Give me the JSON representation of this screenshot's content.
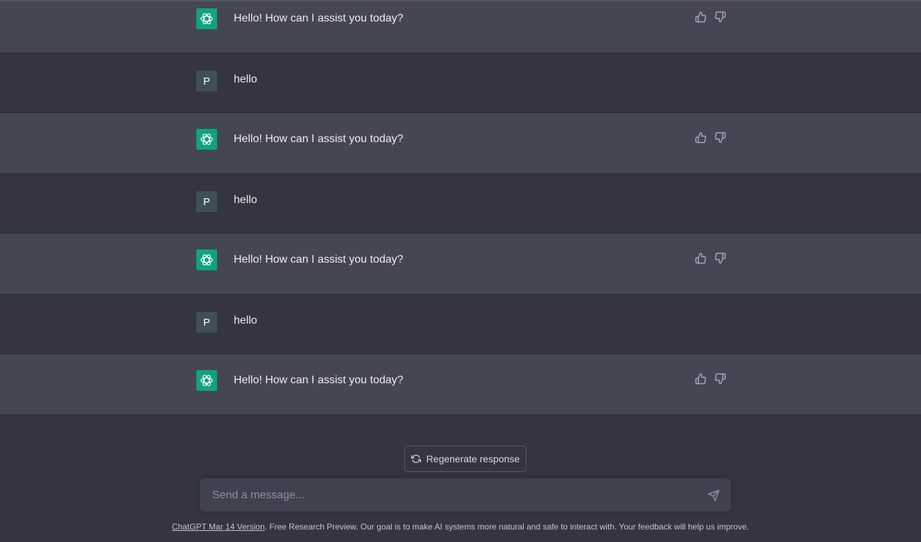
{
  "conversation": {
    "assistant_avatar_icon": "openai-logo-icon",
    "thumbs_up_icon": "thumbs-up-icon",
    "thumbs_down_icon": "thumbs-down-icon",
    "messages": [
      {
        "role": "assistant",
        "text": "Hello! How can I assist you today?"
      },
      {
        "role": "user",
        "avatar_letter": "P",
        "text": "hello"
      },
      {
        "role": "assistant",
        "text": "Hello! How can I assist you today?"
      },
      {
        "role": "user",
        "avatar_letter": "P",
        "text": "hello"
      },
      {
        "role": "assistant",
        "text": "Hello! How can I assist you today?"
      },
      {
        "role": "user",
        "avatar_letter": "P",
        "text": "hello"
      },
      {
        "role": "assistant",
        "text": "Hello! How can I assist you today?"
      }
    ]
  },
  "regenerate": {
    "label": "Regenerate response",
    "icon": "refresh-icon"
  },
  "composer": {
    "placeholder": "Send a message...",
    "send_icon": "send-icon"
  },
  "footer": {
    "link_text": "ChatGPT Mar 14 Version",
    "text": ". Free Research Preview. Our goal is to make AI systems more natural and safe to interact with. Your feedback will help us improve."
  },
  "colors": {
    "assistant_row_bg": "#444654",
    "user_row_bg": "#343541",
    "bot_avatar_bg": "#10a37f",
    "user_avatar_bg": "#3f4f58"
  }
}
